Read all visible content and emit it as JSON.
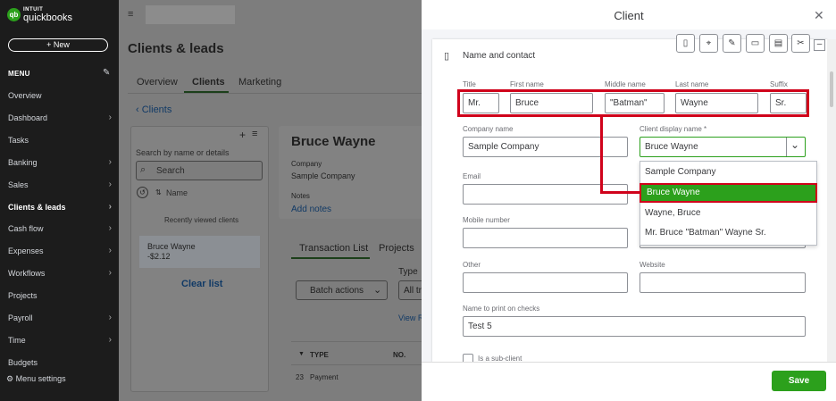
{
  "sidebar": {
    "logo_badge": "qb",
    "brand_top": "INTUIT",
    "brand": "quickbooks",
    "new_label": "+ New",
    "menu_header": "MENU",
    "items": [
      {
        "label": "Overview",
        "chevron": false
      },
      {
        "label": "Dashboard",
        "chevron": true
      },
      {
        "label": "Tasks",
        "chevron": false
      },
      {
        "label": "Banking",
        "chevron": true
      },
      {
        "label": "Sales",
        "chevron": true
      },
      {
        "label": "Clients & leads",
        "chevron": true,
        "active": true
      },
      {
        "label": "Cash flow",
        "chevron": true
      },
      {
        "label": "Expenses",
        "chevron": true
      },
      {
        "label": "Workflows",
        "chevron": true
      },
      {
        "label": "Projects",
        "chevron": false
      },
      {
        "label": "Payroll",
        "chevron": true
      },
      {
        "label": "Time",
        "chevron": true
      },
      {
        "label": "Budgets",
        "chevron": false
      }
    ],
    "menu_settings": "Menu settings"
  },
  "main": {
    "page_title": "Clients & leads",
    "tabs": [
      "Overview",
      "Clients",
      "Marketing"
    ],
    "back_link": "Clients",
    "list": {
      "search_hint": "Search by name or details",
      "search_placeholder": "Search",
      "sort_label": "Name",
      "recent_label": "Recently viewed clients",
      "recent_name": "Bruce Wayne",
      "recent_amount": "-$2.12",
      "clear_label": "Clear list"
    },
    "detail": {
      "name": "Bruce Wayne",
      "company_label": "Company",
      "company_value": "Sample Company",
      "notes_label": "Notes",
      "add_notes": "Add notes"
    },
    "tl_tabs": [
      "Transaction List",
      "Projects"
    ],
    "type_label": "Type",
    "batch_actions": "Batch actions",
    "all_tr": "All tr",
    "view_link": "View R",
    "table": {
      "headers": [
        "TYPE",
        "NO."
      ],
      "row": {
        "date": "23",
        "type": "Payment"
      }
    }
  },
  "drawer": {
    "title": "Client",
    "section_title": "Name and contact",
    "labels": {
      "title": "Title",
      "first": "First name",
      "middle": "Middle name",
      "last": "Last name",
      "suffix": "Suffix",
      "company": "Company name",
      "display": "Client display name *",
      "email": "Email",
      "mobile": "Mobile number",
      "other": "Other",
      "website": "Website",
      "checks": "Name to print on checks",
      "subclient": "Is a sub-client"
    },
    "values": {
      "title": "Mr.",
      "first": "Bruce",
      "middle": "\"Batman\"",
      "last": "Wayne",
      "suffix": "Sr.",
      "company": "Sample Company",
      "display": "Bruce Wayne",
      "email": "",
      "mobile": "",
      "other": "",
      "website": "",
      "checks": "Test 5"
    },
    "display_options": [
      "Sample Company",
      "Bruce Wayne",
      "Wayne, Bruce",
      "Mr. Bruce \"Batman\" Wayne Sr."
    ],
    "selected_option": "Bruce Wayne",
    "save_label": "Save",
    "highlight_color": "#d0021b",
    "accent_color": "#2ca01c"
  }
}
